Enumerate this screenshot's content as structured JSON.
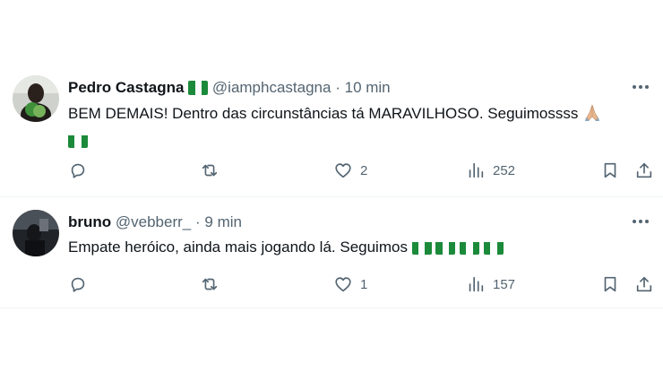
{
  "tweets": [
    {
      "author_name": "Pedro Castagna",
      "handle": "@iamphcastagna",
      "separator": "·",
      "time": "10 min",
      "text": "BEM DEMAIS! Dentro das circunstâncias tá MARAVILHOSO. Seguimossss",
      "emoji": [
        "folded-hands",
        "nigeria-flag"
      ],
      "likes": "2",
      "views": "252"
    },
    {
      "author_name": "bruno",
      "handle": "@vebberr_",
      "separator": "·",
      "time": "9 min",
      "text": "Empate heróico, ainda mais jogando lá. Seguimos",
      "emoji": [
        "nigeria-flag",
        "nigeria-flag",
        "nigeria-flag",
        "nigeria-flag"
      ],
      "likes": "1",
      "views": "157"
    }
  ],
  "colors": {
    "text": "#0f1419",
    "secondary": "#536471",
    "divider": "#eff3f4",
    "flag_green": "#1b8a3a"
  },
  "icons": [
    "reply-icon",
    "retweet-icon",
    "like-icon",
    "views-icon",
    "bookmark-icon",
    "share-icon",
    "more-icon"
  ]
}
